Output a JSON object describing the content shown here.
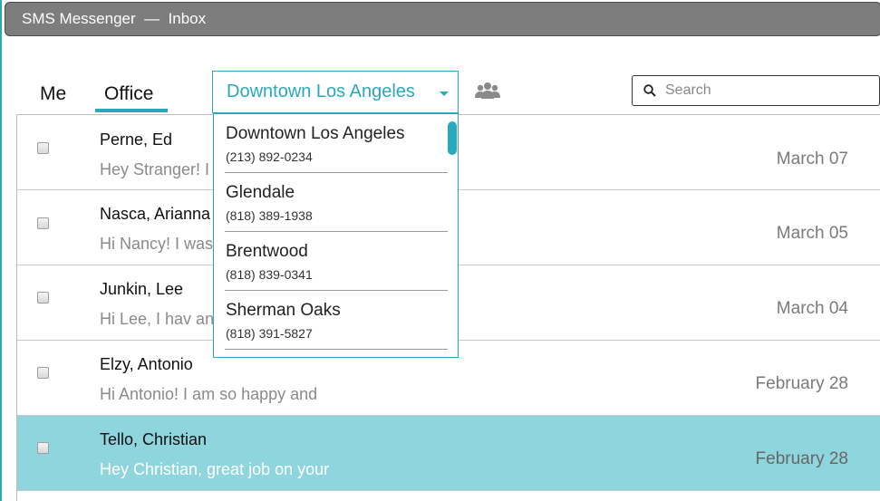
{
  "window": {
    "title": "SMS Messenger  —  Inbox"
  },
  "tabs": [
    {
      "label": "Me"
    },
    {
      "label": "Office"
    }
  ],
  "location_select": {
    "value": "Downtown Los Angeles",
    "options": [
      {
        "name": "Downtown Los Angeles",
        "phone": "(213) 892-0234"
      },
      {
        "name": "Glendale",
        "phone": "(818) 389-1938"
      },
      {
        "name": "Brentwood",
        "phone": "(818) 839-0341"
      },
      {
        "name": "Sherman Oaks",
        "phone": "(818) 391-5827"
      }
    ]
  },
  "search": {
    "placeholder": "Search",
    "value": ""
  },
  "messages": [
    {
      "name": "Perne, Ed",
      "preview": "Hey Stranger! I",
      "date": "March 07",
      "selected": false
    },
    {
      "name": "Nasca, Arianna",
      "preview": "Hi Nancy! I was",
      "date": "March 05",
      "selected": false
    },
    {
      "name": "Junkin, Lee",
      "preview": "Hi Lee, I hav an",
      "date": "March 04",
      "selected": false
    },
    {
      "name": "Elzy, Antonio",
      "preview": "Hi Antonio! I am so happy and",
      "date": "February 28",
      "selected": false
    },
    {
      "name": "Tello, Christian",
      "preview": "Hey Christian,  great job on your",
      "date": "February 28",
      "selected": true
    }
  ],
  "icons": {
    "group": "group-icon",
    "search": "search-icon",
    "caret": "chevron-down-icon"
  },
  "colors": {
    "accent": "#2aa8bd",
    "selected_row": "#8fd5dd",
    "titlebar": "#7d7d7d"
  }
}
